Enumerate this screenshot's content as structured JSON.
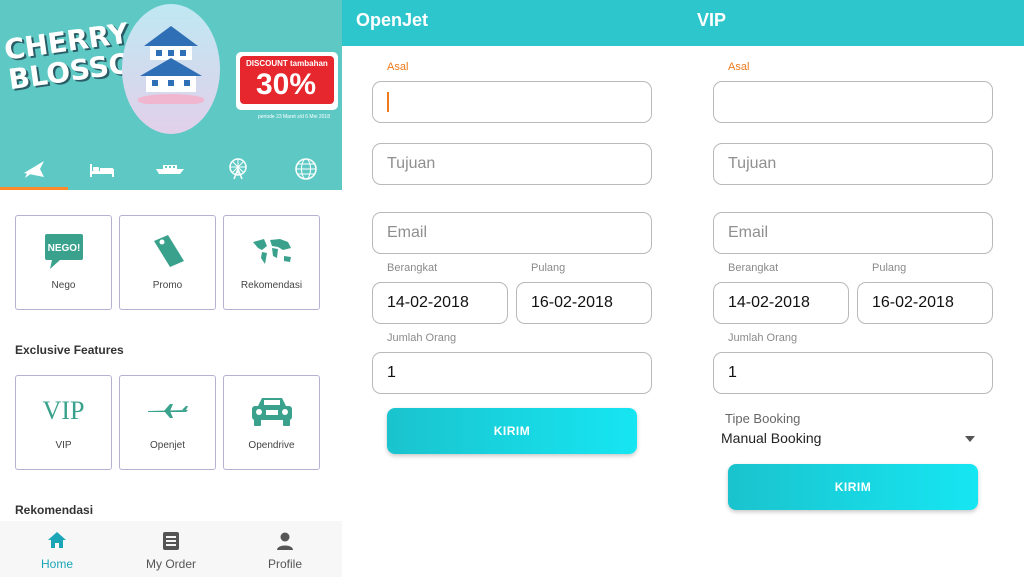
{
  "home": {
    "banner": {
      "title_line1": "CHERRY",
      "title_line2": "BLOSSOM",
      "discount_label": "DISCOUNT tambahan",
      "discount_value": "30%",
      "period": "periode 23 Maret s/d 6 Mei 2018"
    },
    "categories": [
      {
        "icon": "airplane-icon",
        "active": true
      },
      {
        "icon": "bed-icon",
        "active": false
      },
      {
        "icon": "ship-icon",
        "active": false
      },
      {
        "icon": "ferris-wheel-icon",
        "active": false
      },
      {
        "icon": "globe-icon",
        "active": false
      }
    ],
    "menu_tiles": [
      {
        "label": "Nego",
        "icon": "nego-bubble-icon",
        "icon_text": "NEGO!"
      },
      {
        "label": "Promo",
        "icon": "promo-tag-icon"
      },
      {
        "label": "Rekomendasi",
        "icon": "world-map-icon"
      }
    ],
    "exclusive_heading": "Exclusive Features",
    "exclusive_tiles": [
      {
        "label": "VIP",
        "icon_text": "VIP"
      },
      {
        "label": "Openjet",
        "icon": "jet-icon"
      },
      {
        "label": "Opendrive",
        "icon": "car-icon"
      }
    ],
    "rekomendasi_heading": "Rekomendasi",
    "bottom_nav": [
      {
        "label": "Home",
        "icon": "home-icon",
        "active": true
      },
      {
        "label": "My Order",
        "icon": "order-list-icon",
        "active": false
      },
      {
        "label": "Profile",
        "icon": "person-icon",
        "active": false
      }
    ]
  },
  "openjet": {
    "title": "OpenJet",
    "asal_label": "Asal",
    "asal_value": "",
    "tujuan_placeholder": "Tujuan",
    "email_placeholder": "Email",
    "berangkat_label": "Berangkat",
    "berangkat_value": "14-02-2018",
    "pulang_label": "Pulang",
    "pulang_value": "16-02-2018",
    "jumlah_label": "Jumlah Orang",
    "jumlah_value": "1",
    "submit_label": "KIRIM"
  },
  "vip": {
    "title": "VIP",
    "asal_label": "Asal",
    "asal_value": "",
    "tujuan_placeholder": "Tujuan",
    "email_placeholder": "Email",
    "berangkat_label": "Berangkat",
    "berangkat_value": "14-02-2018",
    "pulang_label": "Pulang",
    "pulang_value": "16-02-2018",
    "jumlah_label": "Jumlah Orang",
    "jumlah_value": "1",
    "tipe_label": "Tipe Booking",
    "tipe_value": "Manual Booking",
    "submit_label": "KIRIM"
  },
  "colors": {
    "teal": "#2cc6cc",
    "banner_teal": "#5ec9c4",
    "accent_orange": "#ee7a1e",
    "discount_red": "#e6272d",
    "tile_border": "#b7b0d4"
  }
}
